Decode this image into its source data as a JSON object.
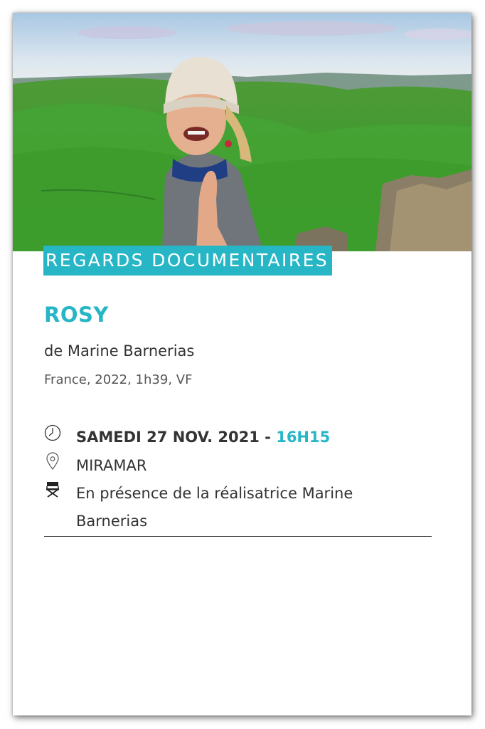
{
  "event": {
    "category": "REGARDS DOCUMENTAIRES",
    "title": "ROSY",
    "director": "de Marine Barnerias",
    "meta": "France, 2022, 1h39, VF",
    "date": "SAMEDI 27 NOV. 2021 -",
    "time": "16H15",
    "venue": "MIRAMAR",
    "guest": "En présence de la réalisatrice Marine Barnerias"
  },
  "icons": {
    "date": "clock-icon",
    "venue": "location-pin-icon",
    "guest": "director-chair-icon"
  },
  "colors": {
    "accent": "#27b6c6",
    "text": "#333333",
    "card": "#ffffff"
  }
}
